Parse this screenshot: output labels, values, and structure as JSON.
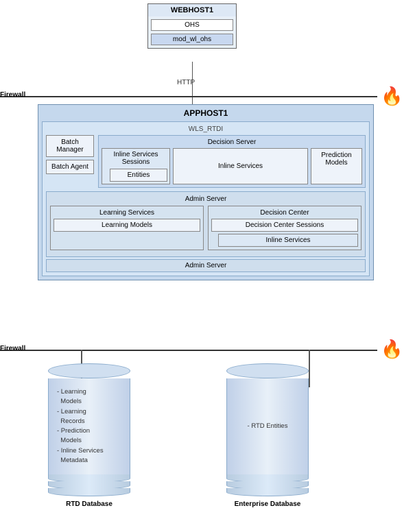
{
  "webhost": {
    "title": "WEBHOST1",
    "ohs": "OHS",
    "mod": "mod_wl_ohs"
  },
  "http": {
    "label": "HTTP"
  },
  "firewall": {
    "top_label": "Firewall",
    "bottom_label": "Firewall"
  },
  "apphost": {
    "title": "APPHOST1",
    "wls_title": "WLS_RTDI",
    "decision_server": {
      "title": "Decision Server",
      "inline_sessions": {
        "title": "Inline Services\nSessions",
        "entities": "Entities"
      },
      "inline_services": "Inline Services",
      "prediction_models": "Prediction\nModels"
    },
    "batch_manager": "Batch\nManager",
    "batch_agent": "Batch\nAgent",
    "admin_server": {
      "title": "Admin Server",
      "learning_services": {
        "title": "Learning Services",
        "models": "Learning Models"
      },
      "decision_center": {
        "title": "Decision Center",
        "sessions": "Decision Center Sessions",
        "inline": "Inline Services"
      }
    },
    "admin_server_bottom": "Admin Server"
  },
  "databases": {
    "rtd": {
      "label": "RTD Database",
      "content": "- Learning\n  Models\n- Learning\n  Records\n- Prediction\n  Models\n- Inline Services\n  Metadata"
    },
    "enterprise": {
      "label": "Enterprise Database",
      "content": "- RTD Entities"
    }
  },
  "flame_emoji": "🔥"
}
